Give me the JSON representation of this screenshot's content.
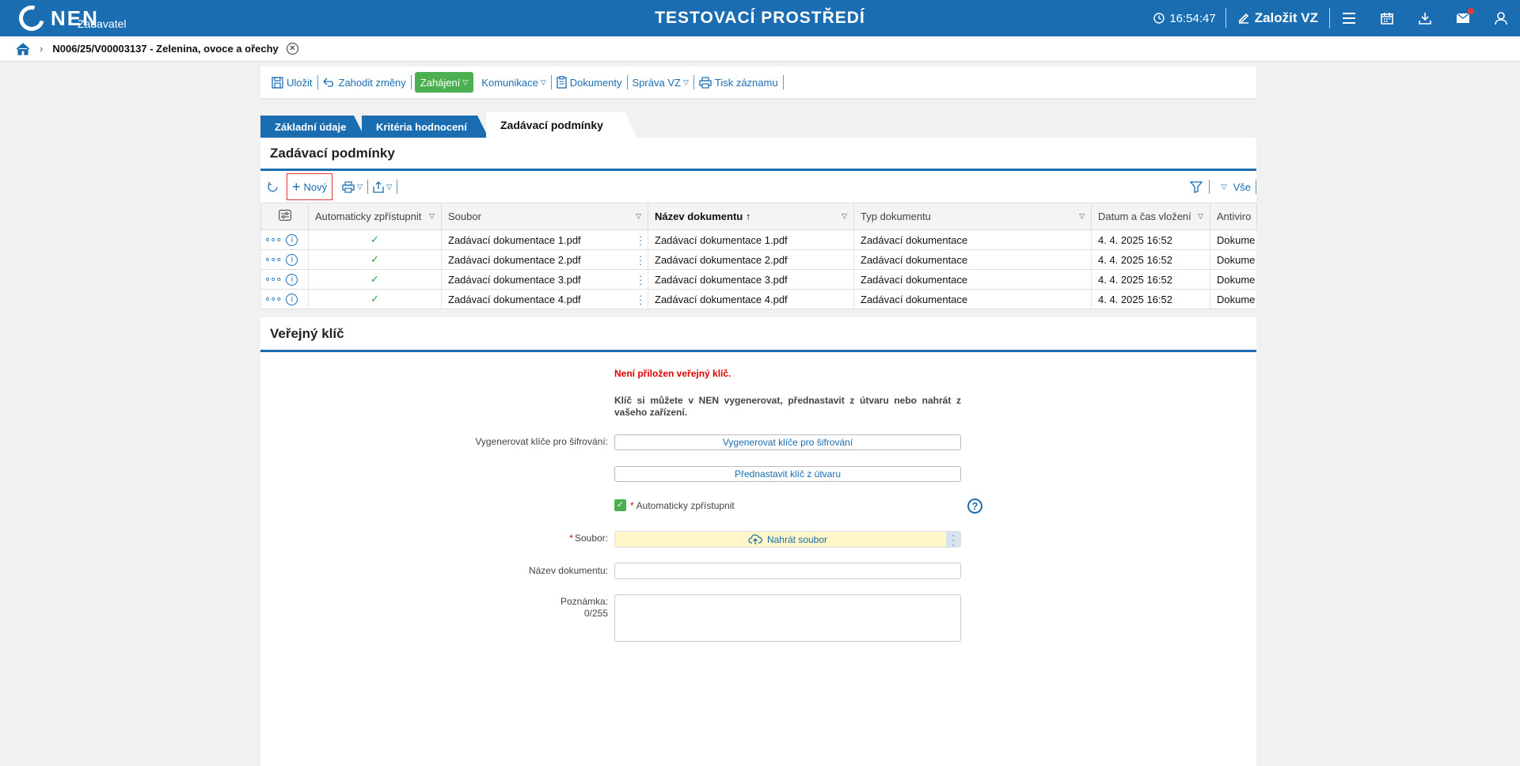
{
  "header": {
    "logo": "NEN",
    "logo_sub": "Zadavatel",
    "env_title": "TESTOVACÍ PROSTŘEDÍ",
    "clock": "16:54:47",
    "create_label": "Založit VZ",
    "icons": [
      "menu-icon",
      "calendar-icon",
      "download-icon",
      "mail-icon",
      "user-icon"
    ]
  },
  "breadcrumb": {
    "title": "N006/25/V00003137 - Zelenina, ovoce a ořechy"
  },
  "toolbar": {
    "save": "Uložit",
    "discard": "Zahodit změny",
    "start": "Zahájení",
    "communication": "Komunikace",
    "documents": "Dokumenty",
    "manage": "Správa VZ",
    "print": "Tisk záznamu"
  },
  "tabs": [
    "Základní údaje",
    "Kritéria hodnocení",
    "Zadávací podmínky"
  ],
  "section1": {
    "title": "Zadávací podmínky",
    "new_label": "Nový",
    "filter_all": "Vše",
    "columns": [
      "Automaticky zpřístupnit",
      "Soubor",
      "Název dokumentu",
      "Typ dokumentu",
      "Datum a čas vložení",
      "Antiviro"
    ],
    "rows": [
      {
        "auto": "✓",
        "file": "Zadávací dokumentace 1.pdf",
        "name": "Zadávací dokumentace 1.pdf",
        "type": "Zadávací dokumentace",
        "date": "4. 4. 2025 16:52",
        "av": "Dokume"
      },
      {
        "auto": "✓",
        "file": "Zadávací dokumentace 2.pdf",
        "name": "Zadávací dokumentace 2.pdf",
        "type": "Zadávací dokumentace",
        "date": "4. 4. 2025 16:52",
        "av": "Dokume"
      },
      {
        "auto": "✓",
        "file": "Zadávací dokumentace 3.pdf",
        "name": "Zadávací dokumentace 3.pdf",
        "type": "Zadávací dokumentace",
        "date": "4. 4. 2025 16:52",
        "av": "Dokume"
      },
      {
        "auto": "✓",
        "file": "Zadávací dokumentace 4.pdf",
        "name": "Zadávací dokumentace 4.pdf",
        "type": "Zadávací dokumentace",
        "date": "4. 4. 2025 16:52",
        "av": "Dokume"
      }
    ]
  },
  "section2": {
    "title": "Veřejný klíč",
    "error": "Není přiložen veřejný klíč.",
    "note": "Klíč si můžete v NEN vygenerovat, přednastavit z útvaru nebo nahrát z vašeho zařízení.",
    "generate_label": "Vygenerovat klíče pro šifrování:",
    "generate_button": "Vygenerovat klíče pro šifrování",
    "preset_button": "Přednastavit klíč z útvaru",
    "auto_publish": "Automaticky zpřístupnit",
    "file_label": "Soubor:",
    "upload_button": "Nahrát soubor",
    "docname_label": "Název dokumentu:",
    "note_label": "Poznámka:",
    "note_counter": "0/255"
  },
  "colors": {
    "primary": "#1b6db2",
    "green": "#4caf50",
    "error": "#e00000",
    "upload_bg": "#fff7c8"
  }
}
